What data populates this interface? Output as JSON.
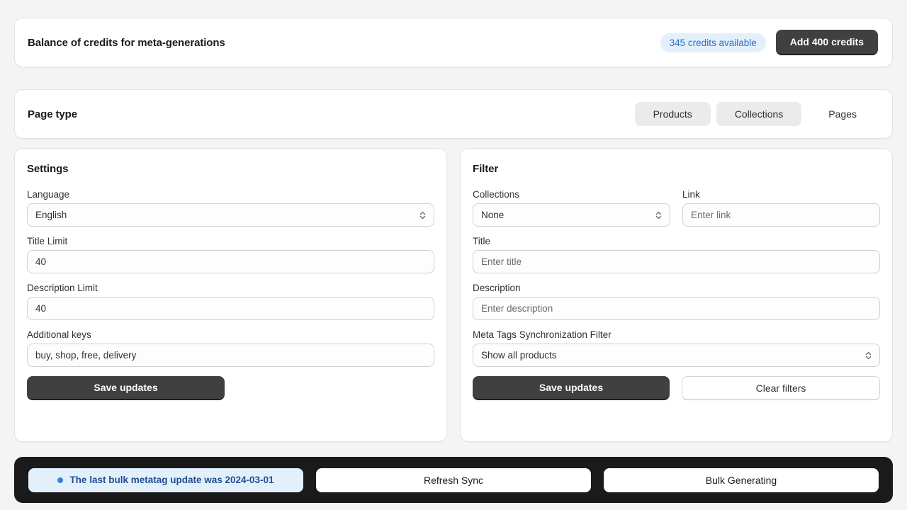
{
  "credits": {
    "title": "Balance of credits for meta-generations",
    "badge": "345 credits available",
    "add_button": "Add 400 credits"
  },
  "page_type": {
    "title": "Page type",
    "tabs": [
      {
        "label": "Products",
        "state": "active"
      },
      {
        "label": "Collections",
        "state": "active"
      },
      {
        "label": "Pages",
        "state": "plain"
      }
    ]
  },
  "settings": {
    "title": "Settings",
    "language_label": "Language",
    "language_value": "English",
    "title_limit_label": "Title Limit",
    "title_limit_value": "40",
    "description_limit_label": "Description Limit",
    "description_limit_value": "40",
    "additional_keys_label": "Additional keys",
    "additional_keys_value": "buy, shop, free, delivery",
    "save_button": "Save updates"
  },
  "filter": {
    "title": "Filter",
    "collections_label": "Collections",
    "collections_value": "None",
    "link_label": "Link",
    "link_placeholder": "Enter link",
    "title_label": "Title",
    "title_placeholder": "Enter title",
    "description_label": "Description",
    "description_placeholder": "Enter description",
    "sync_filter_label": "Meta Tags Synchronization Filter",
    "sync_filter_value": "Show all products",
    "save_button": "Save updates",
    "clear_button": "Clear filters"
  },
  "bottom_bar": {
    "banner_text": "The last bulk metatag update was 2024-03-01",
    "refresh_button": "Refresh Sync",
    "bulk_button": "Bulk Generating"
  },
  "colors": {
    "accent_blue": "#2c6ecb",
    "badge_bg": "#e3f0fb",
    "dark_button": "#404040",
    "bottom_bar": "#1a1a1a",
    "page_bg": "#f4f4f4"
  }
}
